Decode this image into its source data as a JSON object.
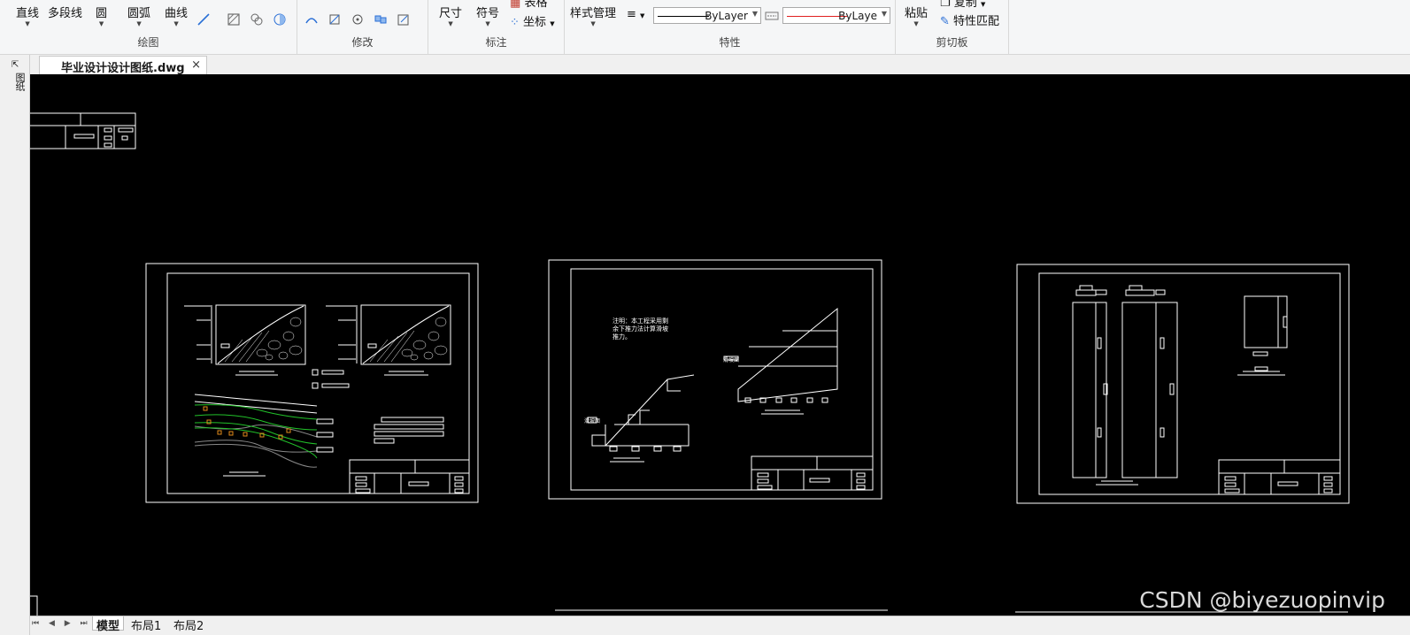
{
  "ribbon": {
    "draw": {
      "label": "绘图",
      "line": "直线",
      "polyline": "多段线",
      "circle": "圆",
      "arc": "圆弧",
      "curve": "曲线"
    },
    "modify": {
      "label": "修改"
    },
    "annotation": {
      "label": "标注",
      "dimension": "尺寸",
      "symbol": "符号",
      "table": "表格",
      "coordinate": "坐标"
    },
    "properties": {
      "label": "特性",
      "style_manager": "样式管理",
      "linetype_value": "ByLayer",
      "color_value": "ByLaye"
    },
    "clipboard": {
      "label": "剪切板",
      "paste": "粘贴",
      "copy": "复制",
      "match_properties": "特性匹配"
    }
  },
  "document": {
    "tab_title": "毕业设计设计图纸.dwg",
    "close": "×"
  },
  "sidebar": {
    "vertical_label": "图纸"
  },
  "drawing": {
    "note_lines": [
      "注明：本工程采用剩",
      "余下推力法计算滑坡",
      "推力。"
    ],
    "label_slip_a": "滑坡面",
    "label_slip_b": "滑坡面"
  },
  "layout_tabs": {
    "nav": "⏮ ◀ ▶ ⏭",
    "model": "模型",
    "layout1": "布局1",
    "layout2": "布局2"
  },
  "watermark": "CSDN @biyezuopinvip",
  "colors": {
    "canvas": "#000000",
    "linework": "#ffffff",
    "green_strata": "#22c22a",
    "orange_marker": "#e08a1a",
    "red_color_line": "#e02020"
  }
}
